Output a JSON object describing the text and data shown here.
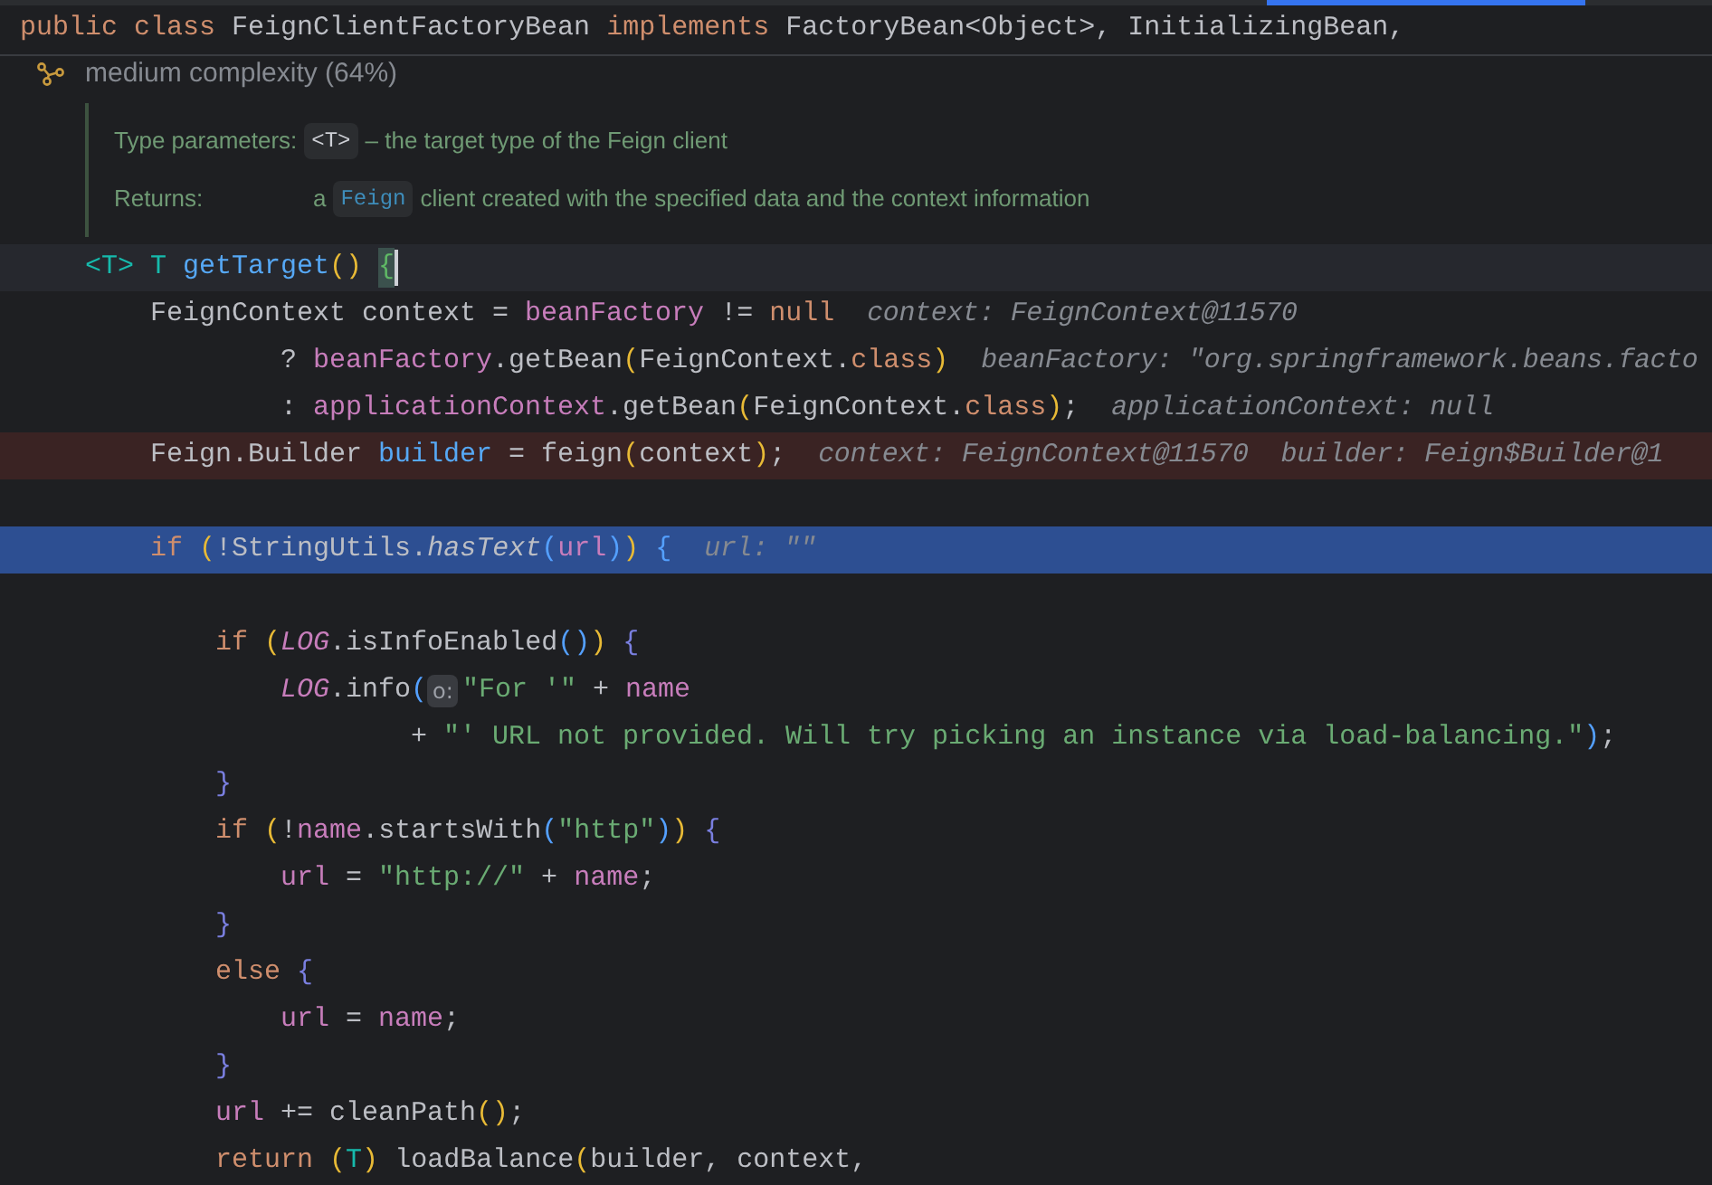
{
  "header": {
    "tokens": [
      {
        "kind": "keyword",
        "text": "public class "
      },
      {
        "kind": "plain",
        "text": "FeignClientFactoryBean "
      },
      {
        "kind": "keyword",
        "text": "implements "
      },
      {
        "kind": "plain",
        "text": "FactoryBean<Object>, InitializingBean,"
      }
    ]
  },
  "complexity": {
    "text": "medium complexity (64%)"
  },
  "doc": {
    "rows": [
      {
        "label": "Type parameters:",
        "chip": "<T>",
        "after": "– the target type of the Feign client"
      },
      {
        "label": "Returns:",
        "before": "a",
        "chip": "Feign",
        "after": "client created with the specified data and the context information"
      }
    ]
  },
  "lines": [
    {
      "kind": "code",
      "caret": true,
      "breakpoint": false,
      "current": false,
      "tokens": [
        {
          "kind": "type_param",
          "text": "<T> T"
        },
        {
          "kind": "method_decl",
          "text": "getTarget"
        },
        {
          "kind": "bracket_a",
          "text": "()"
        },
        {
          "kind": "brace_match",
          "text": "{"
        }
      ],
      "children": [
        {
          "kind": "code",
          "caret": false,
          "breakpoint": false,
          "current": false,
          "tokens": [
            {
              "kind": "plain",
              "text": "FeignContext context ="
            },
            {
              "kind": "field",
              "text": "beanFactory"
            },
            {
              "kind": "plain",
              "text": "!="
            },
            {
              "kind": "keyword",
              "text": "null"
            }
          ],
          "hints": [
            "context: FeignContext@11570"
          ],
          "children": [
            {
              "kind": "continuation",
              "caret": false,
              "breakpoint": false,
              "current": false,
              "tokens": [
                {
                  "kind": "plain",
                  "text": "?"
                },
                {
                  "kind": "field",
                  "text": "beanFactory"
                },
                {
                  "kind": "plain",
                  "text": ".getBean"
                },
                {
                  "kind": "bracket_a",
                  "text": "("
                },
                {
                  "kind": "plain",
                  "text": "FeignContext."
                },
                {
                  "kind": "keyword",
                  "text": "class"
                },
                {
                  "kind": "bracket_a",
                  "text": ")"
                }
              ],
              "hints": [
                "beanFactory: \"org.springframework.beans.facto"
              ]
            },
            {
              "kind": "continuation",
              "caret": false,
              "breakpoint": false,
              "current": false,
              "tokens": [
                {
                  "kind": "plain",
                  "text": ":"
                },
                {
                  "kind": "field",
                  "text": "applicationContext"
                },
                {
                  "kind": "plain",
                  "text": ".getBean"
                },
                {
                  "kind": "bracket_a",
                  "text": "("
                },
                {
                  "kind": "plain",
                  "text": "FeignContext."
                },
                {
                  "kind": "keyword",
                  "text": "class"
                },
                {
                  "kind": "bracket_a",
                  "text": ")"
                },
                {
                  "kind": "plain",
                  "text": ";"
                }
              ],
              "hints": [
                "applicationContext: null"
              ]
            }
          ]
        },
        {
          "kind": "code",
          "caret": false,
          "breakpoint": true,
          "current": false,
          "tokens": [
            {
              "kind": "plain",
              "text": "Feign.Builder"
            },
            {
              "kind": "usage",
              "text": "builder"
            },
            {
              "kind": "plain",
              "text": "= feign"
            },
            {
              "kind": "bracket_a",
              "text": "("
            },
            {
              "kind": "plain",
              "text": "context"
            },
            {
              "kind": "bracket_a",
              "text": ")"
            },
            {
              "kind": "plain",
              "text": ";"
            }
          ],
          "hints": [
            "context: FeignContext@11570",
            "builder: Feign$Builder@1"
          ]
        },
        {
          "kind": "blank",
          "caret": false,
          "breakpoint": false,
          "current": false
        },
        {
          "kind": "code",
          "caret": false,
          "breakpoint": false,
          "current": true,
          "tokens": [
            {
              "kind": "keyword",
              "text": "if"
            },
            {
              "kind": "bracket_a",
              "text": "("
            },
            {
              "kind": "plain",
              "text": "!StringUtils."
            },
            {
              "kind": "static_call",
              "text": "hasText"
            },
            {
              "kind": "bracket_b",
              "text": "("
            },
            {
              "kind": "field",
              "text": "url"
            },
            {
              "kind": "bracket_b",
              "text": ")"
            },
            {
              "kind": "bracket_a",
              "text": ")"
            },
            {
              "kind": "bracket_b",
              "text": "{"
            }
          ],
          "hints": [
            "url: \"\""
          ],
          "children": [
            {
              "kind": "blank",
              "caret": false,
              "breakpoint": false,
              "current": false
            },
            {
              "kind": "code",
              "caret": false,
              "breakpoint": false,
              "current": false,
              "tokens": [
                {
                  "kind": "keyword",
                  "text": "if"
                },
                {
                  "kind": "bracket_a",
                  "text": "("
                },
                {
                  "kind": "static_field",
                  "text": "LOG"
                },
                {
                  "kind": "plain",
                  "text": ".isInfoEnabled"
                },
                {
                  "kind": "bracket_b",
                  "text": "()"
                },
                {
                  "kind": "bracket_a",
                  "text": ")"
                },
                {
                  "kind": "bracket_c",
                  "text": "{"
                }
              ],
              "children": [
                {
                  "kind": "code",
                  "caret": false,
                  "breakpoint": false,
                  "current": false,
                  "tokens": [
                    {
                      "kind": "static_field",
                      "text": "LOG"
                    },
                    {
                      "kind": "plain",
                      "text": ".info"
                    },
                    {
                      "kind": "bracket_b",
                      "text": "("
                    },
                    {
                      "kind": "param_hint",
                      "text": "o:"
                    },
                    {
                      "kind": "string",
                      "text": "\"For '\""
                    },
                    {
                      "kind": "plain",
                      "text": "+"
                    },
                    {
                      "kind": "field",
                      "text": "name"
                    }
                  ],
                  "children": [
                    {
                      "kind": "continuation",
                      "caret": false,
                      "breakpoint": false,
                      "current": false,
                      "tokens": [
                        {
                          "kind": "plain",
                          "text": "+"
                        },
                        {
                          "kind": "string",
                          "text": "\"' URL not provided. Will try picking an instance via load-balancing.\""
                        },
                        {
                          "kind": "bracket_b",
                          "text": ")"
                        },
                        {
                          "kind": "plain",
                          "text": ";"
                        }
                      ]
                    }
                  ]
                }
              ]
            },
            {
              "kind": "code",
              "caret": false,
              "breakpoint": false,
              "current": false,
              "tokens": [
                {
                  "kind": "bracket_c",
                  "text": "}"
                }
              ]
            },
            {
              "kind": "code",
              "caret": false,
              "breakpoint": false,
              "current": false,
              "tokens": [
                {
                  "kind": "keyword",
                  "text": "if"
                },
                {
                  "kind": "bracket_a",
                  "text": "("
                },
                {
                  "kind": "plain",
                  "text": "!"
                },
                {
                  "kind": "field",
                  "text": "name"
                },
                {
                  "kind": "plain",
                  "text": ".startsWith"
                },
                {
                  "kind": "bracket_b",
                  "text": "("
                },
                {
                  "kind": "string",
                  "text": "\"http\""
                },
                {
                  "kind": "bracket_b",
                  "text": ")"
                },
                {
                  "kind": "bracket_a",
                  "text": ")"
                },
                {
                  "kind": "bracket_c",
                  "text": "{"
                }
              ],
              "children": [
                {
                  "kind": "code",
                  "caret": false,
                  "breakpoint": false,
                  "current": false,
                  "tokens": [
                    {
                      "kind": "field",
                      "text": "url"
                    },
                    {
                      "kind": "plain",
                      "text": "="
                    },
                    {
                      "kind": "string",
                      "text": "\"http://\""
                    },
                    {
                      "kind": "plain",
                      "text": "+"
                    },
                    {
                      "kind": "field",
                      "text": "name"
                    },
                    {
                      "kind": "plain",
                      "text": ";"
                    }
                  ]
                }
              ]
            },
            {
              "kind": "code",
              "caret": false,
              "breakpoint": false,
              "current": false,
              "tokens": [
                {
                  "kind": "bracket_c",
                  "text": "}"
                }
              ]
            },
            {
              "kind": "code",
              "caret": false,
              "breakpoint": false,
              "current": false,
              "tokens": [
                {
                  "kind": "keyword",
                  "text": "else"
                },
                {
                  "kind": "bracket_c",
                  "text": "{"
                }
              ],
              "children": [
                {
                  "kind": "code",
                  "caret": false,
                  "breakpoint": false,
                  "current": false,
                  "tokens": [
                    {
                      "kind": "field",
                      "text": "url"
                    },
                    {
                      "kind": "plain",
                      "text": "="
                    },
                    {
                      "kind": "field",
                      "text": "name"
                    },
                    {
                      "kind": "plain",
                      "text": ";"
                    }
                  ]
                }
              ]
            },
            {
              "kind": "code",
              "caret": false,
              "breakpoint": false,
              "current": false,
              "tokens": [
                {
                  "kind": "bracket_c",
                  "text": "}"
                }
              ]
            },
            {
              "kind": "code",
              "caret": false,
              "breakpoint": false,
              "current": false,
              "tokens": [
                {
                  "kind": "field",
                  "text": "url"
                },
                {
                  "kind": "plain",
                  "text": "+= cleanPath"
                },
                {
                  "kind": "bracket_a",
                  "text": "()"
                },
                {
                  "kind": "plain",
                  "text": ";"
                }
              ]
            },
            {
              "kind": "code",
              "caret": false,
              "breakpoint": false,
              "current": false,
              "tokens": [
                {
                  "kind": "keyword",
                  "text": "return"
                },
                {
                  "kind": "bracket_a",
                  "text": "("
                },
                {
                  "kind": "type_param",
                  "text": "T"
                },
                {
                  "kind": "bracket_a",
                  "text": ")"
                },
                {
                  "kind": "plain",
                  "text": "loadBalance"
                },
                {
                  "kind": "bracket_a",
                  "text": "("
                },
                {
                  "kind": "plain",
                  "text": "builder, context,"
                }
              ]
            }
          ]
        }
      ]
    }
  ]
}
